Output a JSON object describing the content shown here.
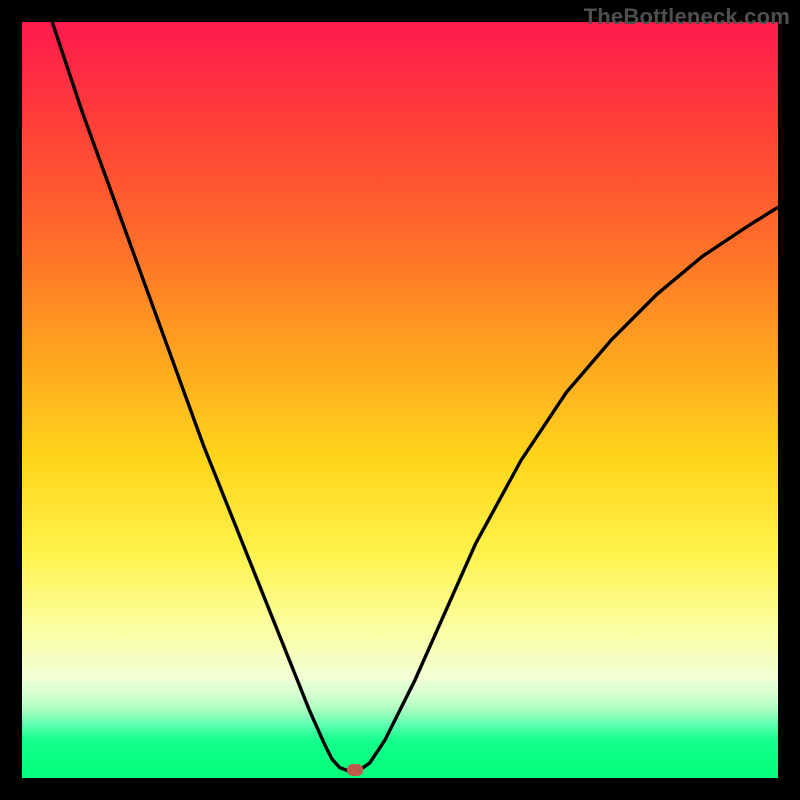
{
  "watermark": "TheBottleneck.com",
  "colors": {
    "frame": "#000000",
    "gradient_top": "#ff1a4e",
    "gradient_mid": "#ffd61a",
    "gradient_bottom": "#00ff7a",
    "curve": "#000000",
    "marker": "#c1584c"
  },
  "chart_data": {
    "type": "line",
    "title": "",
    "xlabel": "",
    "ylabel": "",
    "xlim": [
      0,
      100
    ],
    "ylim": [
      0,
      100
    ],
    "series": [
      {
        "name": "bottleneck-curve",
        "x": [
          4,
          8,
          12,
          16,
          20,
          24,
          28,
          32,
          36,
          38,
          40,
          41,
          42,
          43,
          44,
          45,
          46,
          48,
          52,
          56,
          60,
          66,
          72,
          78,
          84,
          90,
          96,
          100
        ],
        "y": [
          100,
          88,
          77,
          66,
          55,
          44,
          34,
          24,
          14,
          9,
          4.5,
          2.5,
          1.4,
          1,
          1,
          1.3,
          2,
          5,
          13,
          22,
          31,
          42,
          51,
          58,
          64,
          69,
          73,
          75.5
        ]
      }
    ],
    "annotations": [
      {
        "name": "min-marker",
        "x": 44,
        "y": 1
      }
    ],
    "grid": false,
    "legend": false
  }
}
